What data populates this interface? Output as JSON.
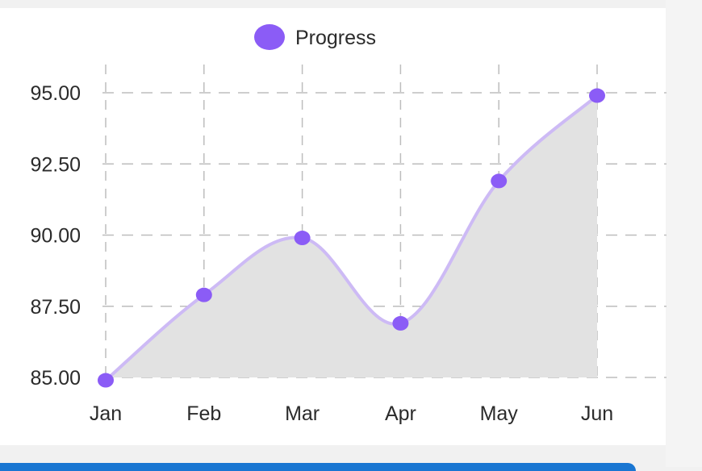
{
  "chart_data": {
    "type": "area",
    "categories": [
      "Jan",
      "Feb",
      "Mar",
      "Apr",
      "May",
      "Jun"
    ],
    "series": [
      {
        "name": "Progress",
        "values": [
          84.9,
          87.9,
          89.9,
          86.9,
          91.9,
          94.9
        ]
      }
    ],
    "ylim": [
      85,
      95
    ],
    "yticks": [
      "85.00",
      "87.50",
      "90.00",
      "92.50",
      "95.00"
    ],
    "grid": true,
    "legend_position": "top-center",
    "colors": {
      "series": "#8b5cf6",
      "line": "#cdbaf5",
      "fill": "#e2e2e2",
      "grid": "#bdbdbd",
      "text": "#2b2b2b"
    }
  }
}
